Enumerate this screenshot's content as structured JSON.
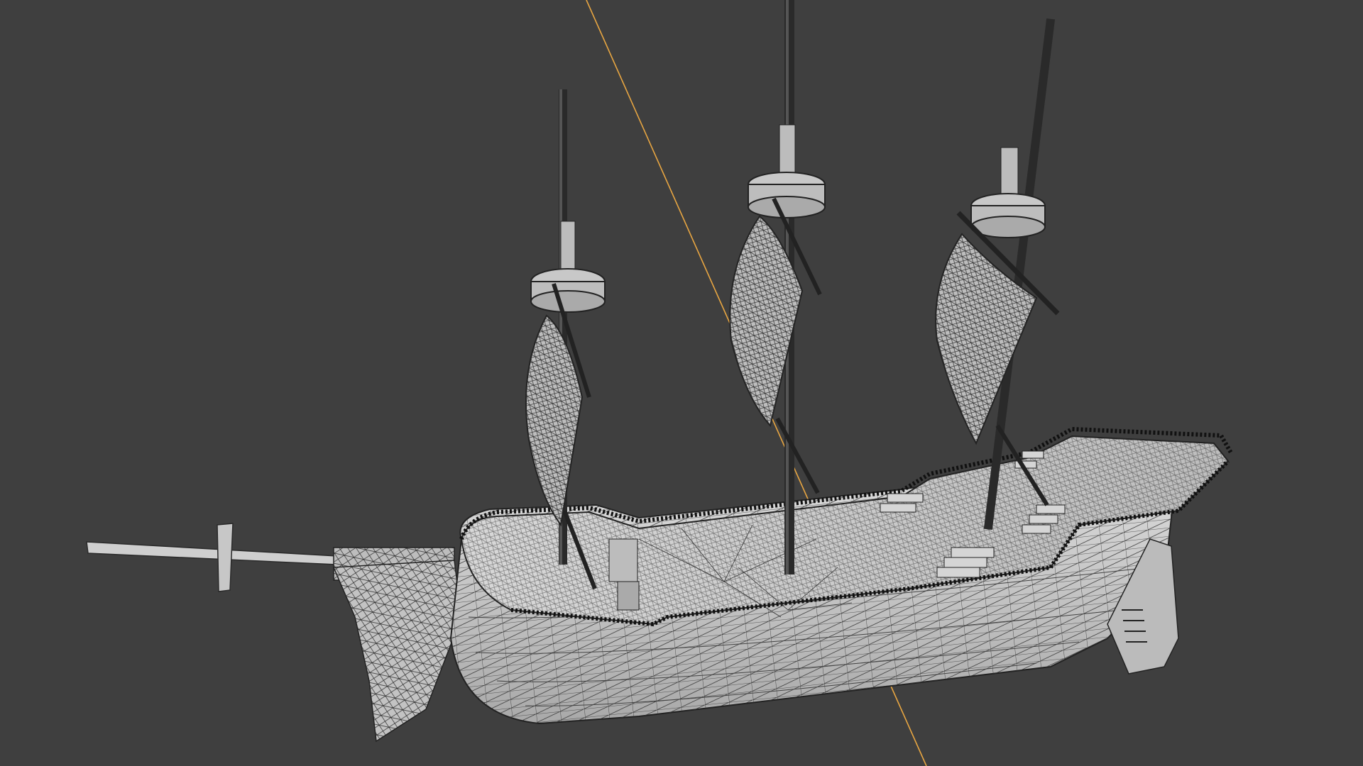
{
  "app": {
    "view": "3D Viewport",
    "shading": "wireframe-overlay"
  },
  "viewport": {
    "background_color": "#3f3f3f",
    "gizmo_axis_color": "#e8a642",
    "mesh_fill_color": "#c9c9c9",
    "mesh_wire_color": "#2a2a2a"
  },
  "scene": {
    "object": "ship-model",
    "masts": 3,
    "sails": 3
  }
}
